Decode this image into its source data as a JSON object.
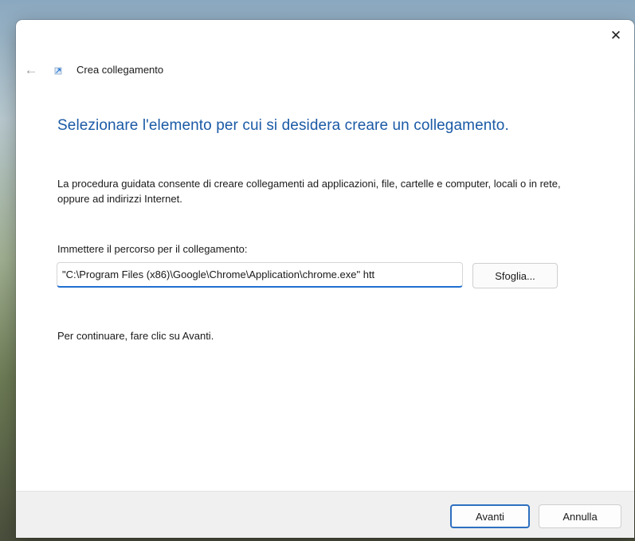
{
  "titlebar": {
    "close_glyph": "✕"
  },
  "wizard": {
    "back_glyph": "←",
    "title": "Crea collegamento",
    "icon": "shortcut-icon",
    "heading": "Selezionare l'elemento per cui si desidera creare un collegamento.",
    "description": "La procedura guidata consente di creare collegamenti ad applicazioni, file, cartelle e computer, locali o in rete, oppure ad indirizzi Internet.",
    "path_label": "Immettere il percorso per il collegamento:",
    "path_value": "\"C:\\Program Files (x86)\\Google\\Chrome\\Application\\chrome.exe\" htt",
    "browse_label": "Sfoglia...",
    "continue_hint": "Per continuare, fare clic su Avanti."
  },
  "footer": {
    "next_label": "Avanti",
    "cancel_label": "Annulla"
  },
  "colors": {
    "heading": "#1b5aa6",
    "accent": "#1f6fd0"
  }
}
